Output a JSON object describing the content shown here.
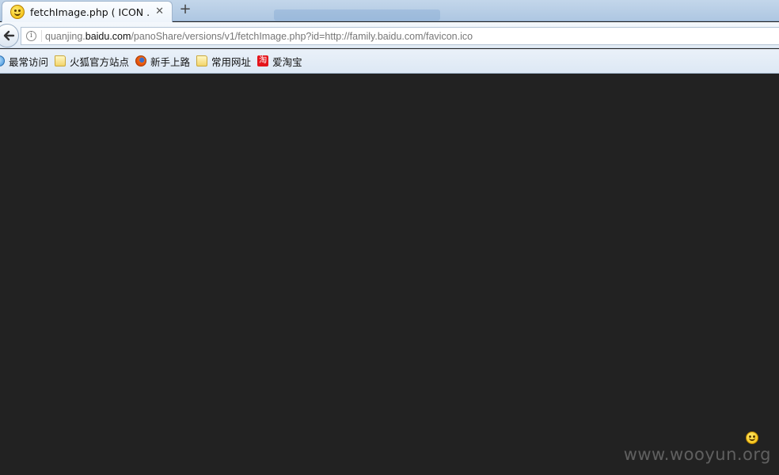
{
  "tab": {
    "title": "fetchImage.php ( ICON ...",
    "close_label": "✕",
    "favicon": "smiley-icon"
  },
  "new_tab_label": "+",
  "address": {
    "prefix": "quanjing.",
    "host": "baidu.com",
    "path": "/panoShare/versions/v1/fetchImage.php?id=http://family.baidu.com/favicon.ico"
  },
  "bookmarks": [
    {
      "label": "最常访问",
      "icon": "most-visited-icon"
    },
    {
      "label": "火狐官方站点",
      "icon": "folder-icon"
    },
    {
      "label": "新手上路",
      "icon": "firefox-icon"
    },
    {
      "label": "常用网址",
      "icon": "folder-icon"
    },
    {
      "label": "爱淘宝",
      "icon": "taobao-icon"
    }
  ],
  "taobao_glyph": "淘",
  "watermark": "www.wooyun.org",
  "colors": {
    "page_background": "#222222",
    "chrome_blue": "#c3d6ea"
  }
}
